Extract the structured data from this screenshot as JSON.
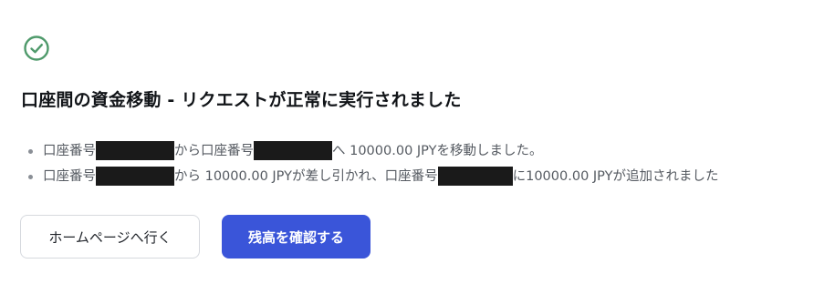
{
  "status": {
    "icon": "check-circle-icon",
    "color": "#4f9a6b"
  },
  "title": "口座間の資金移動 - リクエストが正常に実行されました",
  "details": [
    {
      "prefix": "口座番号",
      "middle": "から口座番号",
      "suffix": "へ 10000.00 JPYを移動しました。"
    },
    {
      "prefix": "口座番号",
      "middle": "から 10000.00 JPYが差し引かれ、口座番号",
      "suffix": "に10000.00 JPYが追加されました"
    }
  ],
  "buttons": {
    "home": "ホームページへ行く",
    "check_balance": "残高を確認する"
  },
  "colors": {
    "primary": "#3a55d9",
    "success": "#4f9a6b"
  }
}
